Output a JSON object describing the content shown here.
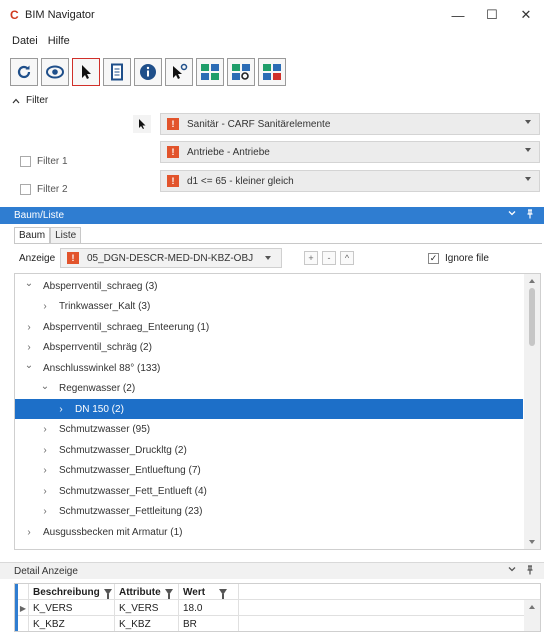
{
  "window": {
    "title": "BIM Navigator",
    "logo_text": "C",
    "controls": {
      "minimize": "—",
      "maximize": "☐",
      "close": "✕"
    }
  },
  "menu": {
    "items": [
      "Datei",
      "Hilfe"
    ]
  },
  "toolbar": {
    "icons": [
      "refresh-icon",
      "eye-icon",
      "select-pointer-icon",
      "document-icon",
      "info-icon",
      "pointer-settings-icon",
      "model-view-icon",
      "model-search-icon",
      "model-check-icon"
    ]
  },
  "filter": {
    "label": "Filter",
    "rows": [
      {
        "value": "Sanitär - CARF Sanitärelemente",
        "warn": "!"
      },
      {
        "check_label": "Filter 1",
        "value": "Antriebe - Antriebe",
        "warn": "!"
      },
      {
        "check_label": "Filter 2",
        "value": "d1 <= 65 - kleiner gleich",
        "warn": "!"
      }
    ]
  },
  "baum_panel": {
    "title": "Baum/Liste",
    "tabs": [
      "Baum",
      "Liste"
    ],
    "anzeige_label": "Anzeige",
    "anzeige_value": "05_DGN-DESCR-MED-DN-KBZ-OBJ",
    "buttons": [
      "+",
      "-",
      "^"
    ],
    "ignore_label": "Ignore file",
    "ignore_checked": true
  },
  "tree": [
    {
      "label": "Absperrventil_schraeg (3)",
      "level": 0,
      "expanded": true
    },
    {
      "label": "Trinkwasser_Kalt (3)",
      "level": 1,
      "expanded": false
    },
    {
      "label": "Absperrventil_schraeg_Enteerung (1)",
      "level": 0,
      "expanded": false
    },
    {
      "label": "Absperrventil_schräg (2)",
      "level": 0,
      "expanded": false
    },
    {
      "label": "Anschlusswinkel 88° (133)",
      "level": 0,
      "expanded": true
    },
    {
      "label": "Regenwasser (2)",
      "level": 1,
      "expanded": true
    },
    {
      "label": "DN 150 (2)",
      "level": 2,
      "expanded": false,
      "selected": true
    },
    {
      "label": "Schmutzwasser (95)",
      "level": 1,
      "expanded": false
    },
    {
      "label": "Schmutzwasser_Druckltg (2)",
      "level": 1,
      "expanded": false
    },
    {
      "label": "Schmutzwasser_Entlueftung (7)",
      "level": 1,
      "expanded": false
    },
    {
      "label": "Schmutzwasser_Fett_Entlueft (4)",
      "level": 1,
      "expanded": false
    },
    {
      "label": "Schmutzwasser_Fettleitung (23)",
      "level": 1,
      "expanded": false
    },
    {
      "label": "Ausgussbecken mit Armatur (1)",
      "level": 0,
      "expanded": false
    }
  ],
  "detail_panel": {
    "title": "Detail Anzeige",
    "columns": [
      "Beschreibung",
      "Attribute",
      "Wert"
    ],
    "rows": [
      [
        "K_VERS",
        "K_VERS",
        "18.0"
      ],
      [
        "K_KBZ",
        "K_KBZ",
        "BR"
      ]
    ]
  },
  "colors": {
    "accent": "#2f7dd1",
    "selection": "#1d6fc8",
    "warning": "#e2542c",
    "logo": "#d03a1f"
  }
}
